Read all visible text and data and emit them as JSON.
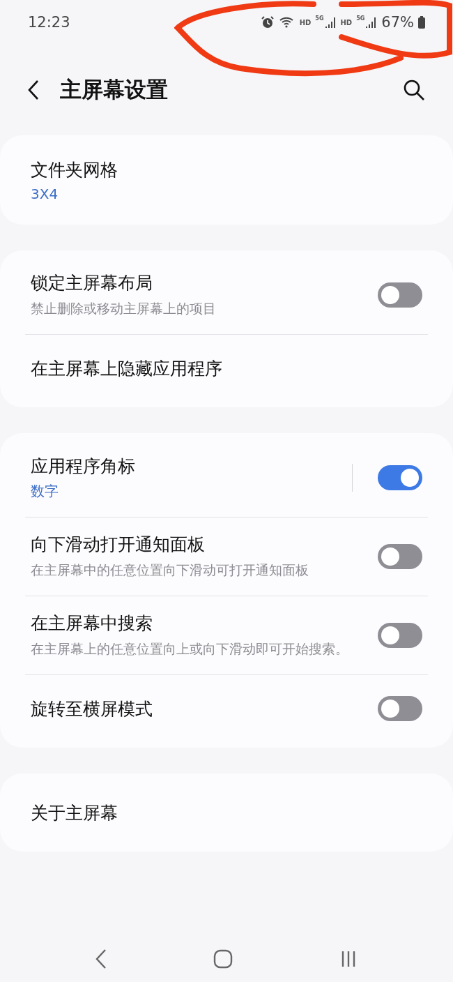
{
  "status_bar": {
    "time": "12:23",
    "hd_1": "HD",
    "network_1": "5G",
    "hd_2": "HD",
    "network_2": "5G",
    "battery": "67%"
  },
  "header": {
    "title": "主屏幕设置"
  },
  "groups": [
    {
      "items": [
        {
          "kind": "link",
          "title": "文件夹网格",
          "value": "3X4"
        }
      ]
    },
    {
      "items": [
        {
          "kind": "toggle",
          "title": "锁定主屏幕布局",
          "subtitle": "禁止删除或移动主屏幕上的项目",
          "on": false
        },
        {
          "kind": "link",
          "title": "在主屏幕上隐藏应用程序"
        }
      ]
    },
    {
      "items": [
        {
          "kind": "split_toggle",
          "title": "应用程序角标",
          "value": "数字",
          "on": true
        },
        {
          "kind": "toggle",
          "title": "向下滑动打开通知面板",
          "subtitle": "在主屏幕中的任意位置向下滑动可打开通知面板",
          "on": false
        },
        {
          "kind": "toggle",
          "title": "在主屏幕中搜索",
          "subtitle": "在主屏幕上的任意位置向上或向下滑动即可开始搜索。",
          "on": false
        },
        {
          "kind": "toggle",
          "title": "旋转至横屏模式",
          "on": false
        }
      ]
    },
    {
      "items": [
        {
          "kind": "link",
          "title": "关于主屏幕"
        }
      ]
    }
  ]
}
